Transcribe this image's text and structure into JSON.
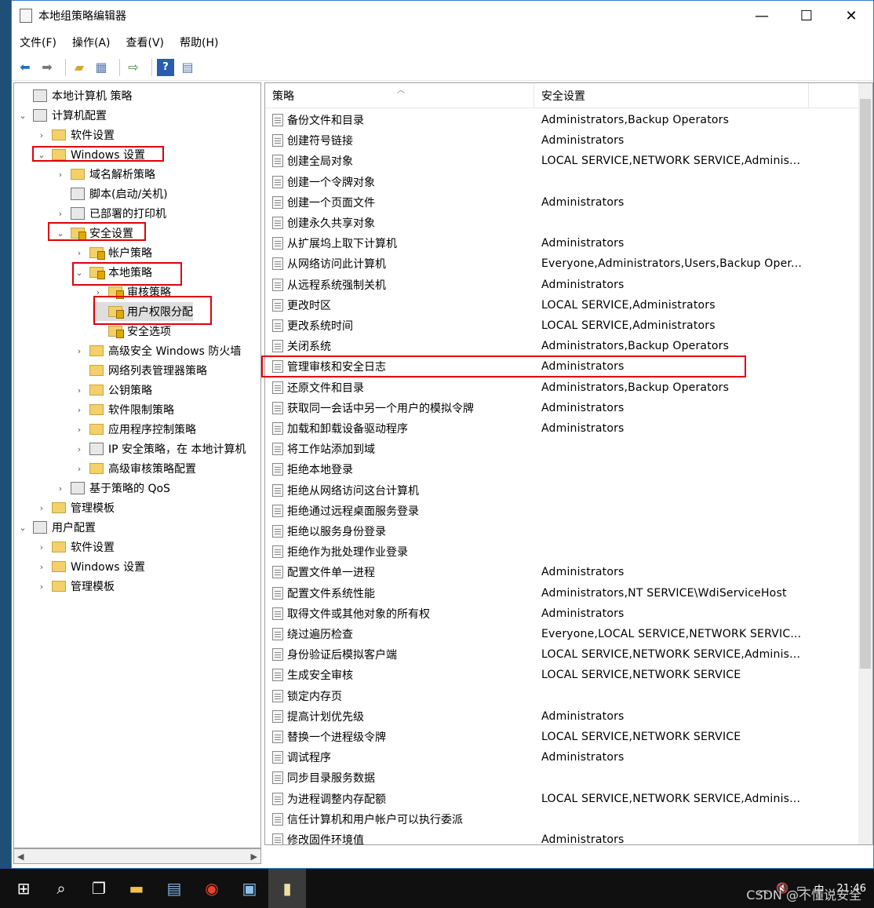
{
  "window": {
    "title": "本地组策略编辑器",
    "minimize": "—",
    "maximize": "☐",
    "close": "✕"
  },
  "menu": [
    "文件(F)",
    "操作(A)",
    "查看(V)",
    "帮助(H)"
  ],
  "toolbar": {
    "icons": [
      "back-arrow-icon",
      "forward-arrow-icon",
      "up-folder-icon",
      "show-tree-icon",
      "export-list-icon",
      "help-icon",
      "properties-icon"
    ]
  },
  "tree": [
    {
      "label": "本地计算机 策略",
      "caret": "",
      "icon": "policy"
    },
    {
      "label": "计算机配置",
      "caret": "⌄",
      "icon": "computer"
    },
    {
      "label": "软件设置",
      "caret": "›",
      "icon": "folder"
    },
    {
      "label": "Windows 设置",
      "caret": "⌄",
      "icon": "folder"
    },
    {
      "label": "域名解析策略",
      "caret": "›",
      "icon": "folder"
    },
    {
      "label": "脚本(启动/关机)",
      "caret": "",
      "icon": "script"
    },
    {
      "label": "已部署的打印机",
      "caret": "›",
      "icon": "printer"
    },
    {
      "label": "安全设置",
      "caret": "⌄",
      "icon": "security"
    },
    {
      "label": "帐户策略",
      "caret": "›",
      "icon": "security"
    },
    {
      "label": "本地策略",
      "caret": "⌄",
      "icon": "security"
    },
    {
      "label": "审核策略",
      "caret": "›",
      "icon": "security"
    },
    {
      "label": "用户权限分配",
      "caret": "",
      "icon": "security"
    },
    {
      "label": "安全选项",
      "caret": "",
      "icon": "security"
    },
    {
      "label": "高级安全 Windows 防火墙",
      "caret": "›",
      "icon": "folder"
    },
    {
      "label": "网络列表管理器策略",
      "caret": "",
      "icon": "folder"
    },
    {
      "label": "公钥策略",
      "caret": "›",
      "icon": "folder"
    },
    {
      "label": "软件限制策略",
      "caret": "›",
      "icon": "folder"
    },
    {
      "label": "应用程序控制策略",
      "caret": "›",
      "icon": "folder"
    },
    {
      "label": "IP 安全策略，在 本地计算机",
      "caret": "›",
      "icon": "ipsec"
    },
    {
      "label": "高级审核策略配置",
      "caret": "›",
      "icon": "folder"
    },
    {
      "label": "基于策略的 QoS",
      "caret": "›",
      "icon": "qos"
    },
    {
      "label": "管理模板",
      "caret": "›",
      "icon": "folder"
    },
    {
      "label": "用户配置",
      "caret": "⌄",
      "icon": "user"
    },
    {
      "label": "软件设置",
      "caret": "›",
      "icon": "folder"
    },
    {
      "label": "Windows 设置",
      "caret": "›",
      "icon": "folder"
    },
    {
      "label": "管理模板",
      "caret": "›",
      "icon": "folder"
    }
  ],
  "list": {
    "columns": [
      "策略",
      "安全设置"
    ],
    "rows": [
      [
        "备份文件和目录",
        "Administrators,Backup Operators"
      ],
      [
        "创建符号链接",
        "Administrators"
      ],
      [
        "创建全局对象",
        "LOCAL SERVICE,NETWORK SERVICE,Adminis..."
      ],
      [
        "创建一个令牌对象",
        ""
      ],
      [
        "创建一个页面文件",
        "Administrators"
      ],
      [
        "创建永久共享对象",
        ""
      ],
      [
        "从扩展坞上取下计算机",
        "Administrators"
      ],
      [
        "从网络访问此计算机",
        "Everyone,Administrators,Users,Backup Oper..."
      ],
      [
        "从远程系统强制关机",
        "Administrators"
      ],
      [
        "更改时区",
        "LOCAL SERVICE,Administrators"
      ],
      [
        "更改系统时间",
        "LOCAL SERVICE,Administrators"
      ],
      [
        "关闭系统",
        "Administrators,Backup Operators"
      ],
      [
        "管理审核和安全日志",
        "Administrators"
      ],
      [
        "还原文件和目录",
        "Administrators,Backup Operators"
      ],
      [
        "获取同一会话中另一个用户的模拟令牌",
        "Administrators"
      ],
      [
        "加载和卸载设备驱动程序",
        "Administrators"
      ],
      [
        "将工作站添加到域",
        ""
      ],
      [
        "拒绝本地登录",
        ""
      ],
      [
        "拒绝从网络访问这台计算机",
        ""
      ],
      [
        "拒绝通过远程桌面服务登录",
        ""
      ],
      [
        "拒绝以服务身份登录",
        ""
      ],
      [
        "拒绝作为批处理作业登录",
        ""
      ],
      [
        "配置文件单一进程",
        "Administrators"
      ],
      [
        "配置文件系统性能",
        "Administrators,NT SERVICE\\WdiServiceHost"
      ],
      [
        "取得文件或其他对象的所有权",
        "Administrators"
      ],
      [
        "绕过遍历检查",
        "Everyone,LOCAL SERVICE,NETWORK SERVIC..."
      ],
      [
        "身份验证后模拟客户端",
        "LOCAL SERVICE,NETWORK SERVICE,Adminis..."
      ],
      [
        "生成安全审核",
        "LOCAL SERVICE,NETWORK SERVICE"
      ],
      [
        "锁定内存页",
        ""
      ],
      [
        "提高计划优先级",
        "Administrators"
      ],
      [
        "替换一个进程级令牌",
        "LOCAL SERVICE,NETWORK SERVICE"
      ],
      [
        "调试程序",
        "Administrators"
      ],
      [
        "同步目录服务数据",
        ""
      ],
      [
        "为进程调整内存配额",
        "LOCAL SERVICE,NETWORK SERVICE,Adminis..."
      ],
      [
        "信任计算机和用户帐户可以执行委派",
        ""
      ],
      [
        "修改固件环境值",
        "Administrators"
      ]
    ]
  },
  "taskbar": {
    "time": "21:46",
    "watermark": "CSDN @不懂说安全"
  }
}
